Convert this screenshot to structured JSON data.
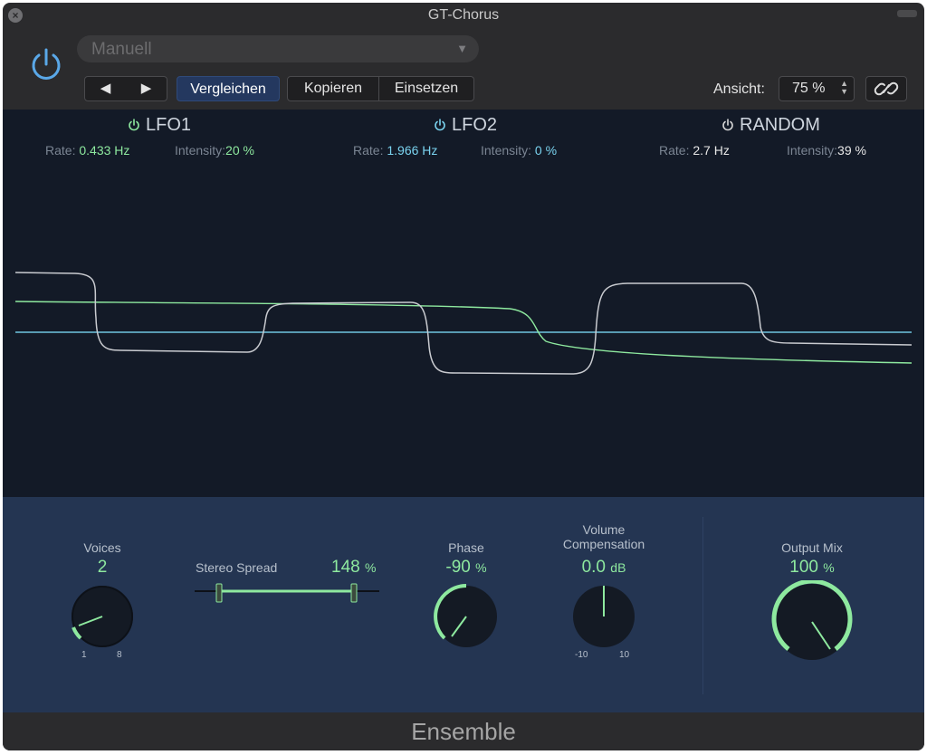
{
  "window": {
    "title": "GT-Chorus",
    "footer_title": "Ensemble"
  },
  "toolbar": {
    "preset": "Manuell",
    "prev_icon": "◀",
    "next_icon": "▶",
    "compare_label": "Vergleichen",
    "copy_label": "Kopieren",
    "paste_label": "Einsetzen",
    "view_label": "Ansicht:",
    "view_value": "75 %"
  },
  "modulators": [
    {
      "name": "LFO1",
      "rate_label": "Rate:",
      "rate_value": "0.433 Hz",
      "intensity_label": "Intensity:",
      "intensity_value": "20 %",
      "color": "#8ee99f"
    },
    {
      "name": "LFO2",
      "rate_label": "Rate:",
      "rate_value": "1.966 Hz",
      "intensity_label": "Intensity:",
      "intensity_value": "0 %",
      "color": "#7ad3ef"
    },
    {
      "name": "RANDOM",
      "rate_label": "Rate:",
      "rate_value": "2.7 Hz",
      "intensity_label": "Intensity:",
      "intensity_value": "39 %",
      "color": "#e6e6e6"
    }
  ],
  "controls": {
    "voices": {
      "label": "Voices",
      "value": "2",
      "min_label": "1",
      "max_label": "8",
      "fraction": 0.14
    },
    "stereo_spread": {
      "label": "Stereo Spread",
      "value": "148",
      "unit": "%"
    },
    "phase": {
      "label": "Phase",
      "value": "-90",
      "unit": "%",
      "fraction": 0.25
    },
    "volume_compensation": {
      "label": "Volume",
      "label2": "Compensation",
      "value": "0.0",
      "unit": "dB",
      "min_label": "-10",
      "max_label": "10",
      "fraction": 0.5
    },
    "output_mix": {
      "label": "Output Mix",
      "value": "100",
      "unit": "%",
      "fraction": 1.0
    }
  },
  "colors": {
    "accent_green": "#8ee99f",
    "accent_blue": "#7ad3ef",
    "power_blue": "#5aa8e8"
  }
}
